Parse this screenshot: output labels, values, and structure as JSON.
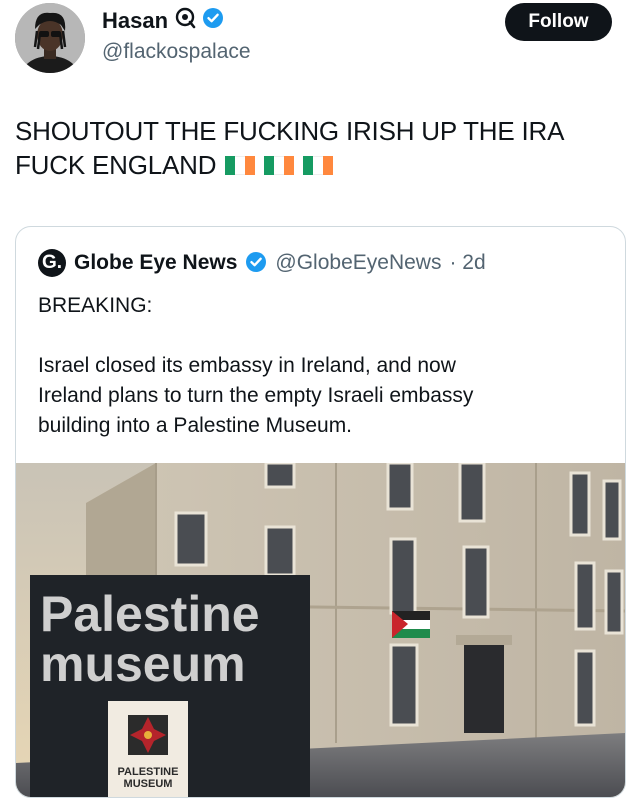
{
  "author": {
    "name": "Hasan",
    "handle": "@flackospalace",
    "follow_label": "Follow"
  },
  "tweet": {
    "line1": "SHOUTOUT THE FUCKING IRISH UP THE IRA",
    "line2": "FUCK ENGLAND",
    "flag_colors": [
      "#169b62",
      "#ffffff",
      "#ff883e"
    ]
  },
  "quoted": {
    "logo_letter": "G.",
    "name": "Globe Eye News",
    "handle": "@GlobeEyeNews",
    "time": "· 2d",
    "heading": "BREAKING:",
    "body_lines": [
      "Israel closed its embassy in Ireland, and now",
      "Ireland plans to turn the empty Israeli embassy",
      "building into a Palestine Museum."
    ],
    "image": {
      "sign_line1": "Palestine",
      "sign_line2": "museum",
      "badge_line1": "PALESTINE",
      "badge_line2": "MUSEUM"
    }
  },
  "colors": {
    "verified": "#1d9bf0",
    "text": "#0f1419",
    "secondary": "#536471"
  }
}
